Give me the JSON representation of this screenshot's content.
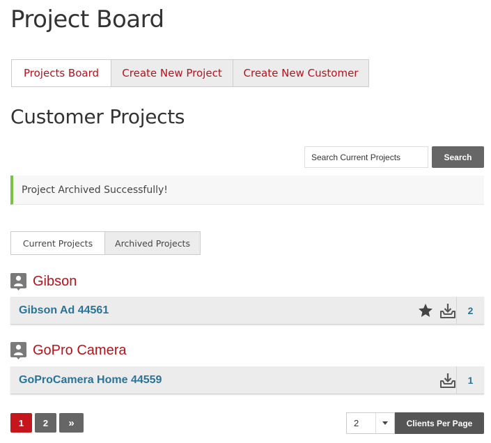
{
  "page": {
    "title": "Project Board"
  },
  "top_tabs": [
    {
      "label": "Projects Board",
      "active": true
    },
    {
      "label": "Create New Project",
      "active": false
    },
    {
      "label": "Create New Customer",
      "active": false
    }
  ],
  "section": {
    "title": "Customer Projects"
  },
  "search": {
    "placeholder": "Search Current Projects",
    "button_label": "Search"
  },
  "alert": {
    "message": "Project Archived Successfully!",
    "color": "#7ac143"
  },
  "sub_tabs": [
    {
      "label": "Current Projects",
      "active": true
    },
    {
      "label": "Archived Projects",
      "active": false
    }
  ],
  "customers": [
    {
      "name": "Gibson",
      "icon": "person-icon",
      "projects": [
        {
          "name": "Gibson Ad 44561",
          "starred": true,
          "icons": [
            "star-icon",
            "inbox-download-icon"
          ],
          "count": "2"
        }
      ]
    },
    {
      "name": "GoPro Camera",
      "icon": "person-icon",
      "projects": [
        {
          "name": "GoProCamera Home 44559",
          "starred": false,
          "icons": [
            "inbox-download-icon"
          ],
          "count": "1"
        }
      ]
    }
  ],
  "pagination": {
    "pages": [
      "1",
      "2"
    ],
    "current": "1",
    "next_label": "»"
  },
  "per_page": {
    "selected": "2",
    "button_label": "Clients Per Page"
  },
  "colors": {
    "accent_red": "#b5121b",
    "link_blue": "#2a7397",
    "button_gray": "#666666"
  }
}
